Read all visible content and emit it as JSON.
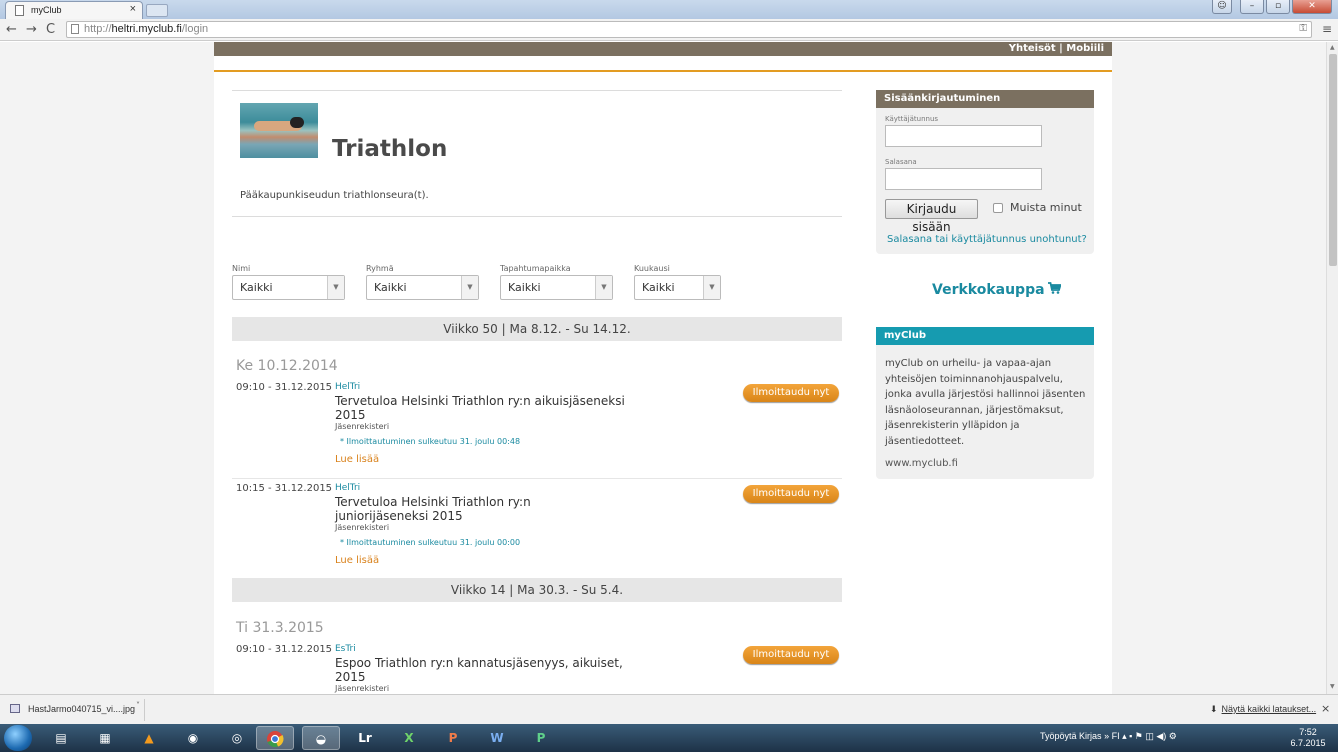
{
  "browser": {
    "tab_title": "myClub",
    "tab_close": "×",
    "url_scheme": "http://",
    "url_host": "heltri.myclub.fi",
    "url_path": "/login"
  },
  "site": {
    "top_links": "Yhteisöt | Mobiili",
    "club_title": "Triathlon",
    "club_description": "Pääkaupunkiseudun triathlonseura(t).",
    "filters": [
      {
        "label": "Nimi",
        "value": "Kaikki"
      },
      {
        "label": "Ryhmä",
        "value": "Kaikki"
      },
      {
        "label": "Tapahtumapaikka",
        "value": "Kaikki"
      },
      {
        "label": "Kuukausi",
        "value": "Kaikki"
      }
    ],
    "weeks": [
      {
        "label": "Viikko 50 | Ma 8.12. - Su 14.12.",
        "day": "Ke 10.12.2014"
      },
      {
        "label": "Viikko 14 | Ma 30.3. - Su 5.4.",
        "day": "Ti 31.3.2015"
      }
    ],
    "events": [
      {
        "time": "09:10 - 31.12.2015",
        "group": "HelTri",
        "title": "Tervetuloa Helsinki Triathlon ry:n aikuisjäseneksi 2015",
        "subtitle": "Jäsenrekisteri",
        "note": "* Ilmoittautuminen sulkeutuu 31. joulu 00:48",
        "more": "Lue lisää",
        "button": "Ilmoittaudu nyt"
      },
      {
        "time": "10:15 - 31.12.2015",
        "group": "HelTri",
        "title": "Tervetuloa Helsinki Triathlon ry:n juniorijäseneksi 2015",
        "subtitle": "Jäsenrekisteri",
        "note": "* Ilmoittautuminen sulkeutuu 31. joulu 00:00",
        "more": "Lue lisää",
        "button": "Ilmoittaudu nyt"
      },
      {
        "time": "09:10 - 31.12.2015",
        "group": "EsTri",
        "title": "Espoo Triathlon ry:n kannatusjäsenyys, aikuiset, 2015",
        "subtitle": "Jäsenrekisteri",
        "button": "Ilmoittaudu nyt"
      }
    ]
  },
  "login": {
    "heading": "Sisäänkirjautuminen",
    "username_label": "Käyttäjätunnus",
    "password_label": "Salasana",
    "submit_label": "Kirjaudu sisään",
    "remember_label": "Muista minut",
    "forgot_link": "Salasana tai käyttäjätunnus unohtunut?"
  },
  "shop": {
    "label": "Verkkokauppa",
    "icon": "cart-icon"
  },
  "myclub": {
    "heading": "myClub",
    "text": "myClub on urheilu- ja vapaa-ajan yhteisöjen toiminnanohjauspalvelu, jonka avulla järjestösi hallinnoi jäsenten läsnäoloseurannan, järjestömaksut, jäsenrekisterin ylläpidon ja jäsentiedotteet.",
    "link": "www.myclub.fi"
  },
  "downloads": {
    "file_name": "HastJarmo040715_vi....jpg",
    "show_all": "Näytä kaikki lataukset...",
    "close": "×"
  },
  "taskbar": {
    "tray_text": "Työpöytä",
    "tray_kirjas": "Kirjas",
    "tray_lang": "FI",
    "time": "7:52",
    "date": "6.7.2015",
    "apps": [
      "explorer",
      "files",
      "vlc",
      "network",
      "steam",
      "chrome",
      "hdd",
      "Lr",
      "X",
      "P",
      "W",
      "P"
    ]
  },
  "colors": {
    "brown_bar": "#7b7060",
    "orange_accent": "#e39c22",
    "teal_link": "#1a8aa0",
    "button_orange": "#e8941f"
  }
}
